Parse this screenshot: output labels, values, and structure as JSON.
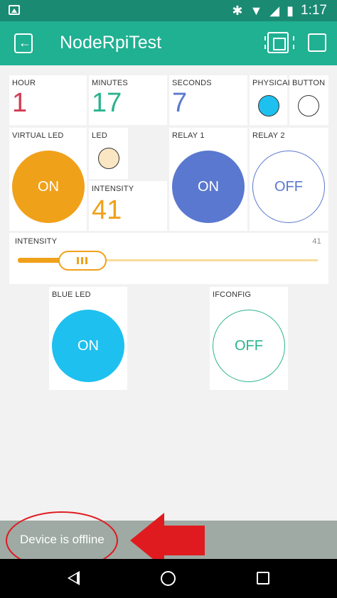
{
  "status_bar": {
    "time": "1:17",
    "bluetooth_glyph": "✱",
    "wifi_glyph": "▼",
    "signal_glyph": "◢",
    "battery_glyph": "▮"
  },
  "app": {
    "title": "NodeRpiTest"
  },
  "tiles": {
    "hour": {
      "label": "HOUR",
      "value": "1",
      "color": "#d13c52"
    },
    "minutes": {
      "label": "MINUTES",
      "value": "17",
      "color": "#2ab38f"
    },
    "seconds": {
      "label": "SECONDS",
      "value": "7",
      "color": "#5a78cf"
    },
    "physical": {
      "label": "PHYSICAL",
      "color": "#1ec0ef"
    },
    "button": {
      "label": "BUTTON"
    },
    "virtual_led": {
      "label": "VIRTUAL LED",
      "state": "ON",
      "color": "#f0a11a"
    },
    "led": {
      "label": "LED",
      "color": "#fbe6c4"
    },
    "intensity_display": {
      "label": "INTENSITY",
      "value": "41",
      "color": "#f0a11a"
    },
    "relay1": {
      "label": "RELAY 1",
      "state": "ON",
      "color": "#5a78cf"
    },
    "relay2": {
      "label": "RELAY 2",
      "state": "OFF",
      "color": "#5a78cf"
    },
    "slider": {
      "label": "INTENSITY",
      "value_label": "41",
      "value": 41,
      "max": 255,
      "color": "#f0a11a"
    },
    "blue_led": {
      "label": "BLUE LED",
      "state": "ON",
      "color": "#1ec0ef"
    },
    "ifconfig": {
      "label": "IFCONFIG",
      "state": "OFF",
      "color": "#2ab38f"
    }
  },
  "footer": {
    "offline_message": "Device is offline",
    "annotation_color": "#e01b1f"
  }
}
